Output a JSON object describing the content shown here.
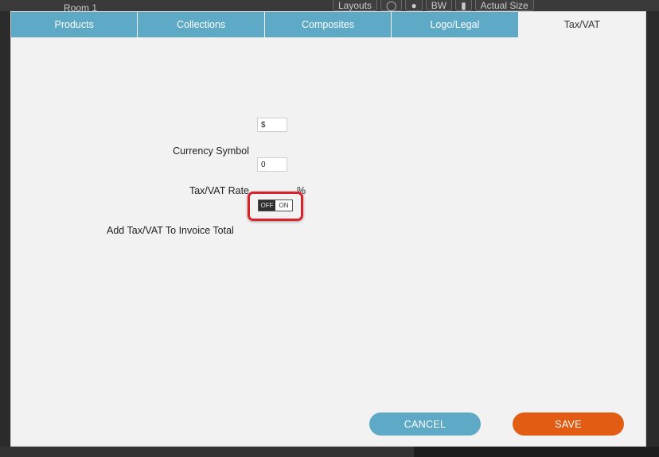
{
  "background": {
    "room_label": "Room 1",
    "toolbar": [
      "Layouts",
      "◯",
      "●",
      "BW",
      "▮",
      "Actual Size"
    ]
  },
  "tabs": [
    {
      "label": "Products",
      "active": false
    },
    {
      "label": "Collections",
      "active": false
    },
    {
      "label": "Composites",
      "active": false
    },
    {
      "label": "Logo/Legal",
      "active": false
    },
    {
      "label": "Tax/VAT",
      "active": true
    }
  ],
  "form": {
    "currency_symbol": {
      "label": "Currency Symbol",
      "value": "$"
    },
    "tax_rate": {
      "label": "Tax/VAT Rate",
      "value": "0",
      "suffix": "%"
    },
    "add_tax": {
      "label": "Add Tax/VAT To Invoice Total",
      "off_label": "OFF",
      "on_label": "ON",
      "state": "OFF"
    }
  },
  "buttons": {
    "cancel": "CANCEL",
    "save": "SAVE"
  },
  "colors": {
    "tab_accent": "#5ea9c6",
    "save_accent": "#e35c13",
    "highlight": "#d8232a"
  }
}
